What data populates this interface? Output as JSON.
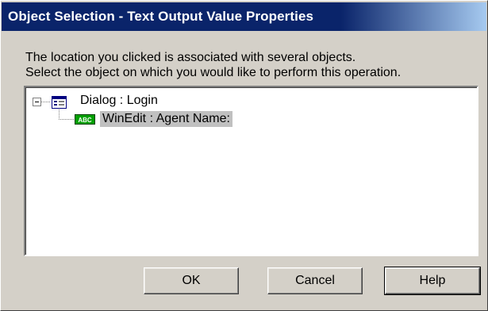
{
  "window": {
    "title": "Object Selection - Text Output Value Properties"
  },
  "message": {
    "line1": "The location you clicked is associated with several objects.",
    "line2": "Select the object on which you would like to perform this operation."
  },
  "tree": {
    "root": {
      "label": "Dialog : Login",
      "icon": "dialog-window-icon",
      "expanded": true
    },
    "children": [
      {
        "label": "WinEdit : Agent Name:",
        "icon": "edit-field-abc-icon",
        "icon_text": "ABC",
        "selected": true
      }
    ]
  },
  "buttons": {
    "ok": "OK",
    "cancel": "Cancel",
    "help": "Help"
  },
  "colors": {
    "title_bar": "#0a246a",
    "face": "#d4d0c8",
    "selection": "#c0c0c0",
    "edit_icon": "#00a000"
  }
}
